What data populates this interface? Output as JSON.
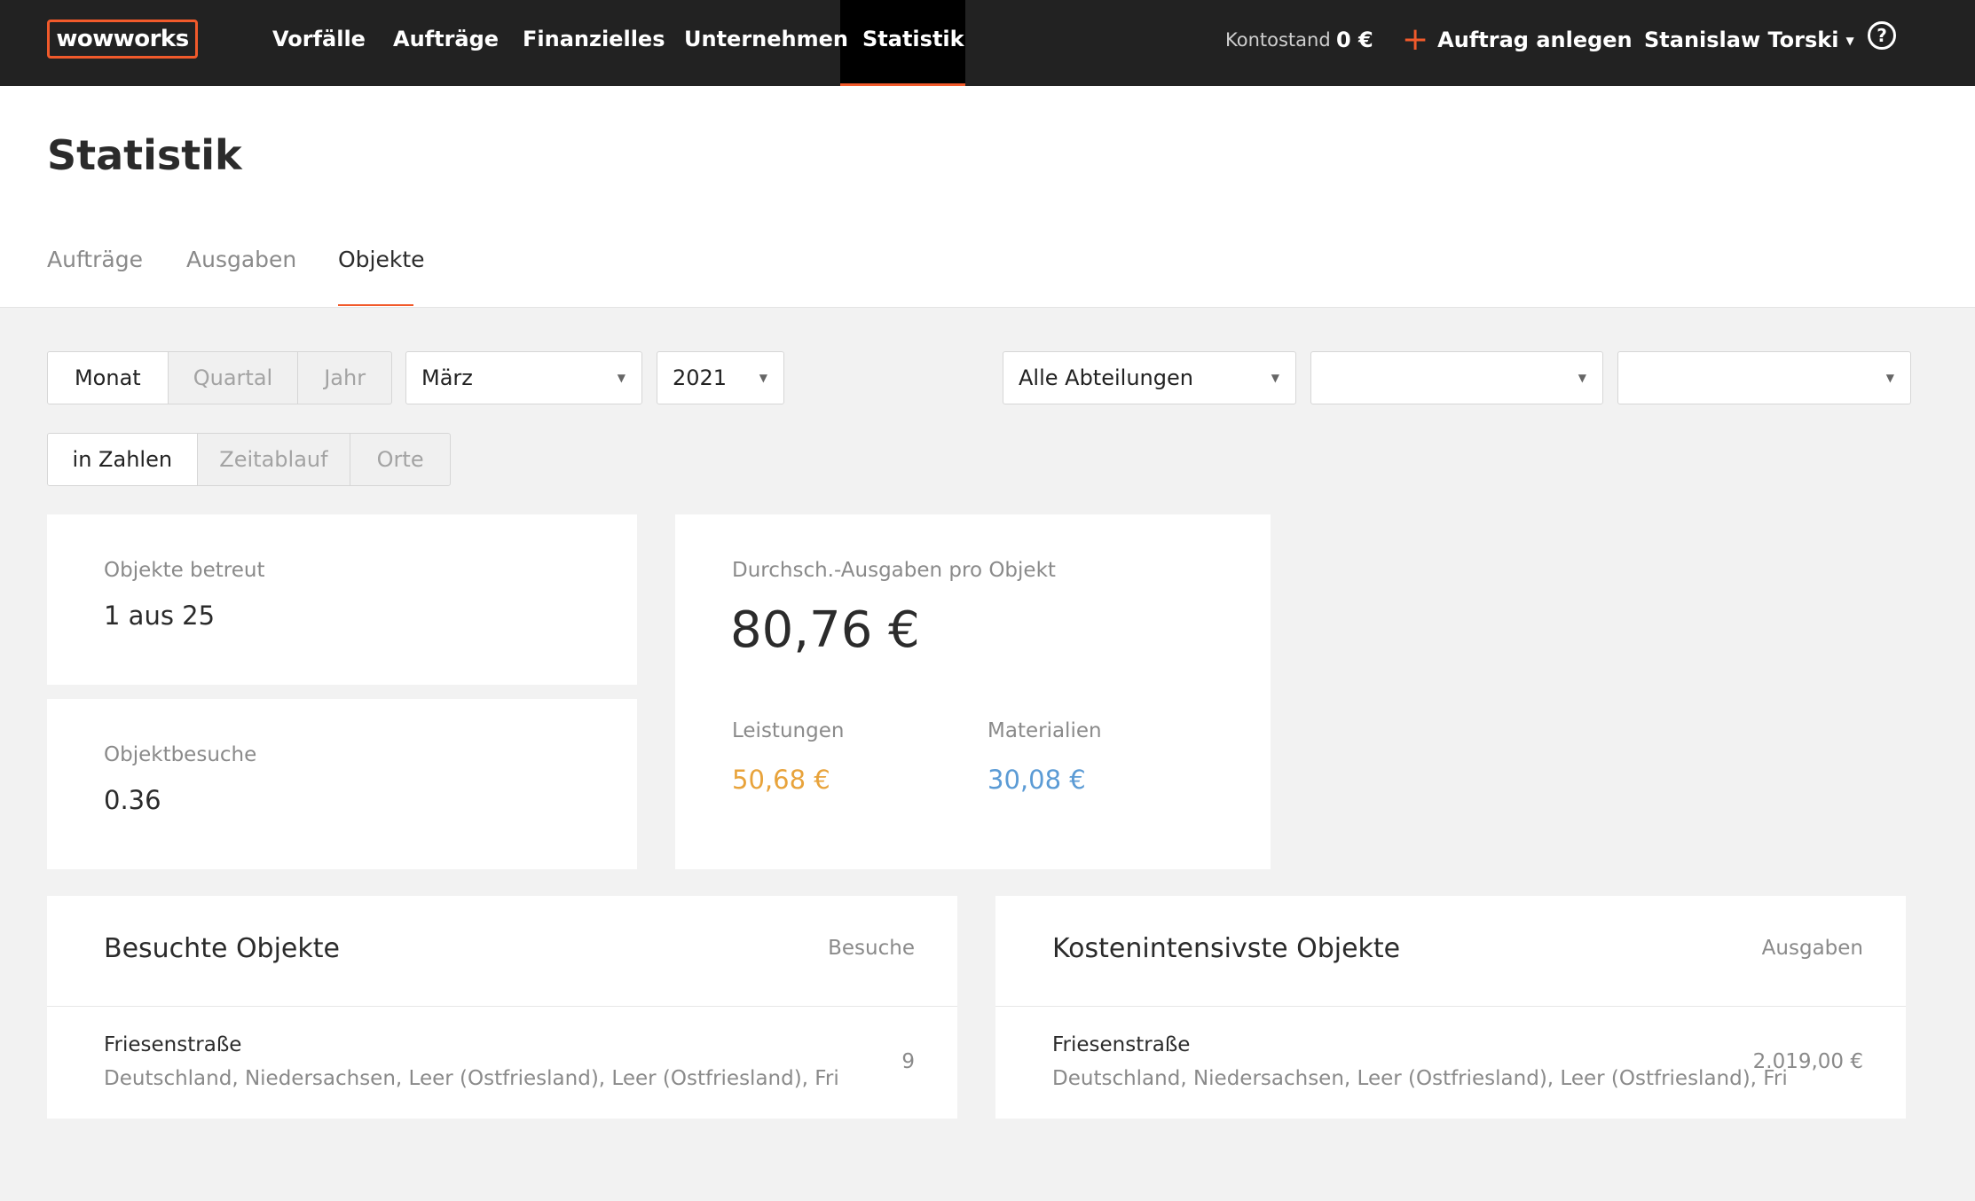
{
  "nav": {
    "logo": "wowworks",
    "items": [
      "Vorfälle",
      "Aufträge",
      "Finanzielles",
      "Unternehmen",
      "Statistik"
    ],
    "balance_label": "Kontostand",
    "balance_value": "0 €",
    "add_order": "Auftrag anlegen",
    "user_name": "Stanislaw Torski",
    "help": "?"
  },
  "page": {
    "title": "Statistik",
    "tabs": [
      "Aufträge",
      "Ausgaben",
      "Objekte"
    ],
    "active_tab": "Objekte"
  },
  "filters": {
    "period_options": [
      "Monat",
      "Quartal",
      "Jahr"
    ],
    "period_selected": "Monat",
    "month": "März",
    "year": "2021",
    "department": "Alle Abteilungen",
    "filter2": "",
    "filter3": ""
  },
  "view": {
    "options": [
      "in Zahlen",
      "Zeitablauf",
      "Orte"
    ],
    "selected": "in Zahlen"
  },
  "stats": {
    "objects_label": "Objekte betreut",
    "objects_value": "1 aus 25",
    "visits_label": "Objektbesuche",
    "visits_value": "0.36",
    "avg_label": "Durchsch.-Ausgaben pro Objekt",
    "avg_value": "80,76 €",
    "services_label": "Leistungen",
    "services_value": "50,68 €",
    "materials_label": "Materialien",
    "materials_value": "30,08 €"
  },
  "visited": {
    "title": "Besuchte Objekte",
    "column": "Besuche",
    "rows": [
      {
        "name": "Friesenstraße",
        "address": "Deutschland, Niedersachsen, Leer (Ostfriesland), Leer (Ostfriesland), Fri",
        "value": "9"
      }
    ]
  },
  "costly": {
    "title": "Kostenintensivste Objekte",
    "column": "Ausgaben",
    "rows": [
      {
        "name": "Friesenstraße",
        "address": "Deutschland, Niedersachsen, Leer (Ostfriesland), Leer (Ostfriesland), Fri",
        "value": "2.019,00 €"
      }
    ]
  },
  "colors": {
    "accent": "#f15a2b",
    "services": "#e8a33b",
    "materials": "#5b9bd5",
    "topbar": "#222222"
  }
}
